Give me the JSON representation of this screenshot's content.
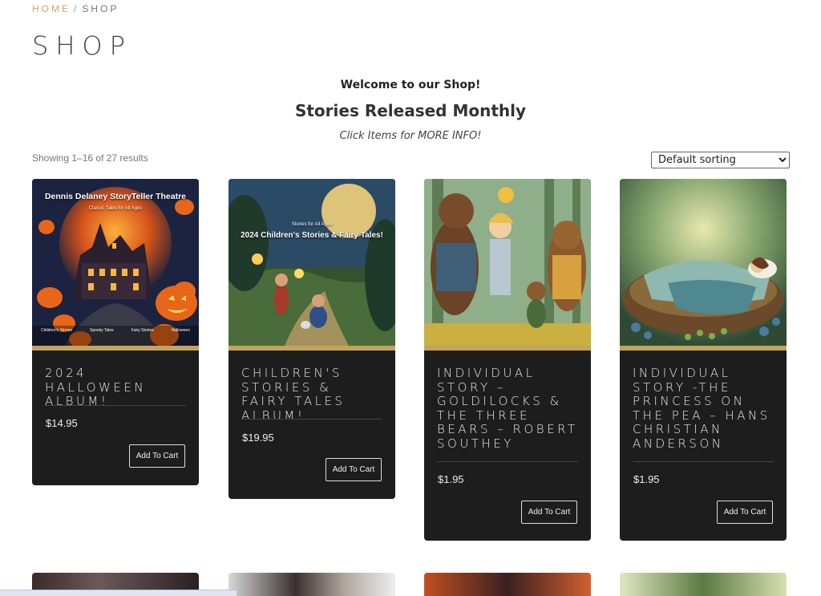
{
  "breadcrumb": {
    "home": "HOME",
    "separator": "/",
    "current": "SHOP"
  },
  "page_title": "SHOP",
  "intro": {
    "welcome": "Welcome to our Shop!",
    "headline": "Stories Released Monthly",
    "hint": "Click Items for MORE INFO!"
  },
  "result_count": "Showing 1–16 of 27 results",
  "sorting": {
    "selected": "Default sorting"
  },
  "products": [
    {
      "title": "2024 HALLOWEEN ALBUM!",
      "price": "$14.95",
      "button": "Add To Cart",
      "art": {
        "top_line": "Dennis Delaney StoryTeller Theatre",
        "sub_line": "Classic Tales for All Ages",
        "bottom_labels": [
          "Children's Stories",
          "Spooky Tales",
          "Fairy Stories",
          "Halloween"
        ]
      }
    },
    {
      "title": "CHILDREN'S STORIES & FAIRY TALES ALBUM!",
      "price": "$19.95",
      "button": "Add To Cart",
      "art": {
        "sub_line": "Stories for All Ages",
        "top_line": "2024 Children's Stories & Fairy Tales!"
      }
    },
    {
      "title": "INDIVIDUAL STORY – GOLDILOCKS & THE THREE BEARS – ROBERT SOUTHEY",
      "price": "$1.95",
      "button": "Add To Cart"
    },
    {
      "title": "INDIVIDUAL STORY -THE PRINCESS ON THE PEA – HANS CHRISTIAN ANDERSON",
      "price": "$1.95",
      "button": "Add To Cart"
    }
  ],
  "colors": {
    "card_bg": "#1d1d1d",
    "gold_band": "#c4a35a",
    "breadcrumb_accent": "#c9a86a"
  }
}
